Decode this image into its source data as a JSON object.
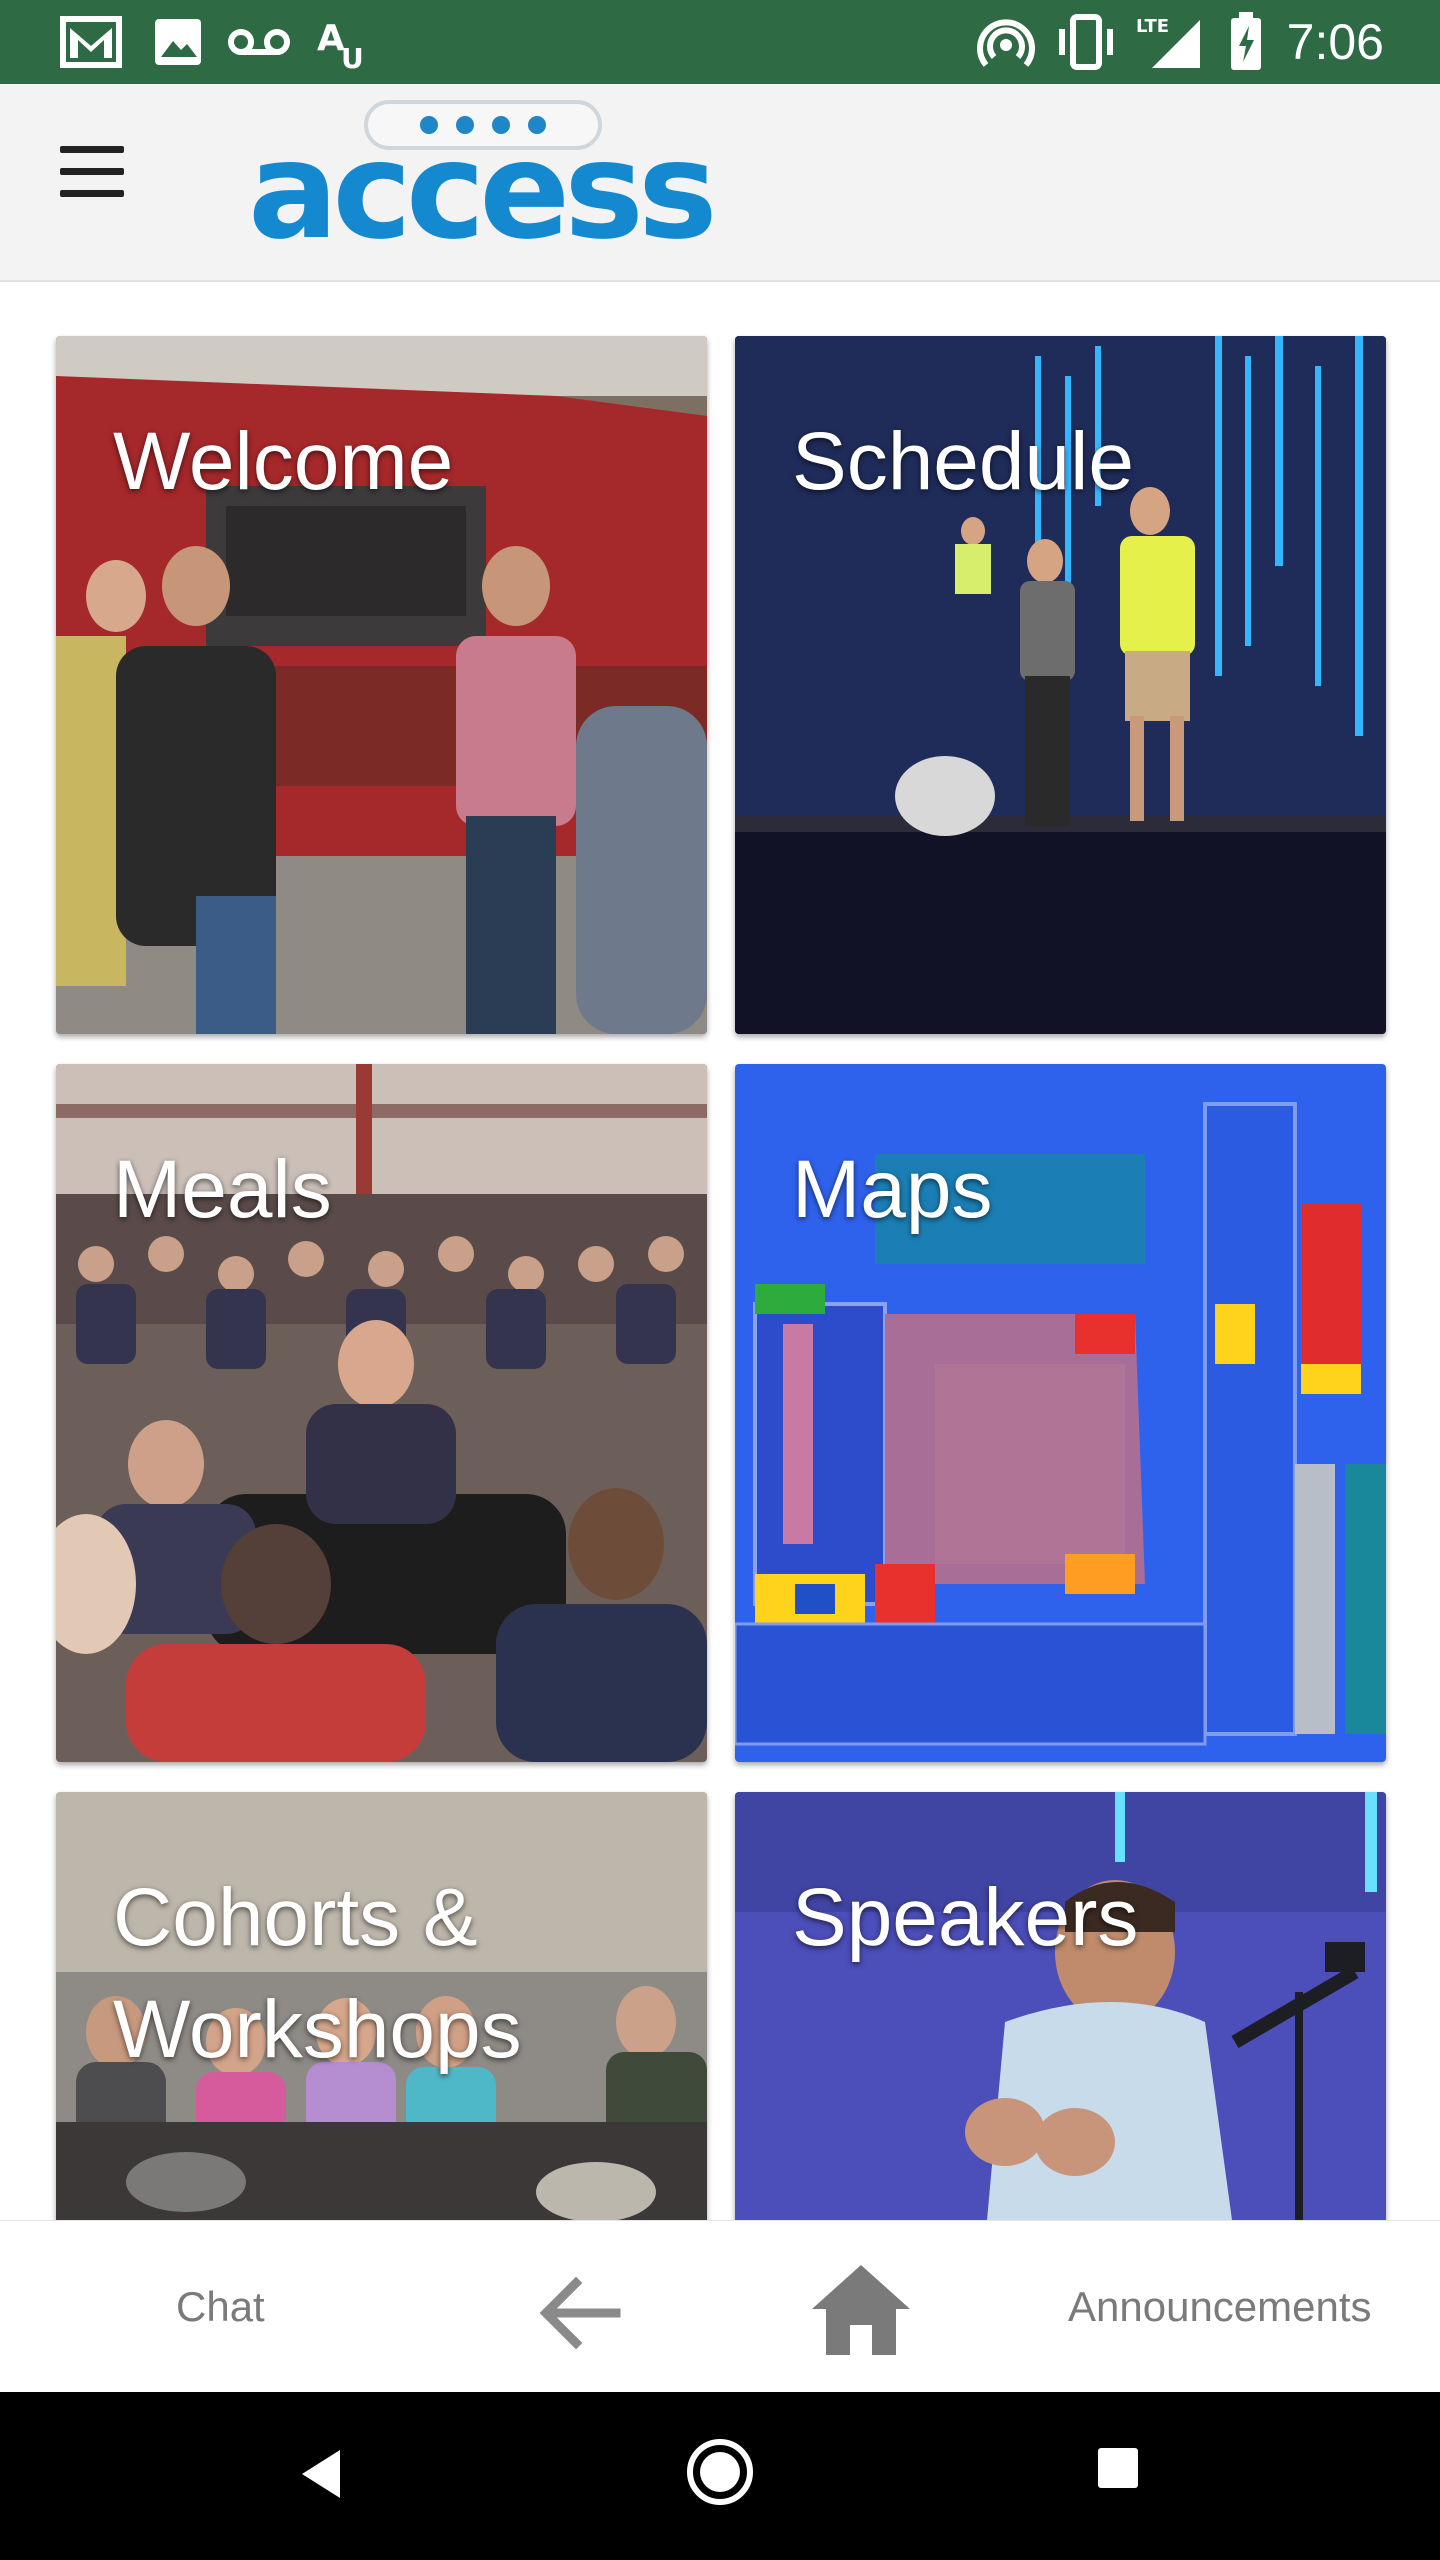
{
  "status_bar": {
    "time": "7:06",
    "left_icons": [
      "gmail-icon",
      "image-icon",
      "voicemail-icon",
      "translate-icon"
    ],
    "right_icons": [
      "hotspot-icon",
      "vibrate-icon",
      "lte-signal-icon",
      "battery-charging-icon"
    ],
    "lte_label": "LTE",
    "bg_color": "#2e6b45"
  },
  "app_bar": {
    "menu_icon": "hamburger-menu-icon",
    "logo_text": "access",
    "logo_color": "#1589cf"
  },
  "tiles": [
    {
      "label": "Welcome"
    },
    {
      "label": "Schedule"
    },
    {
      "label": "Meals"
    },
    {
      "label": "Maps"
    },
    {
      "label": "Cohorts & Workshops"
    },
    {
      "label": "Speakers"
    }
  ],
  "bottom_nav": {
    "chat": "Chat",
    "back_icon": "arrow-left-icon",
    "home_icon": "home-icon",
    "announcements": "Announcements"
  },
  "system_nav": {
    "back": "triangle-back-icon",
    "home": "circle-home-icon",
    "recents": "square-recents-icon"
  }
}
